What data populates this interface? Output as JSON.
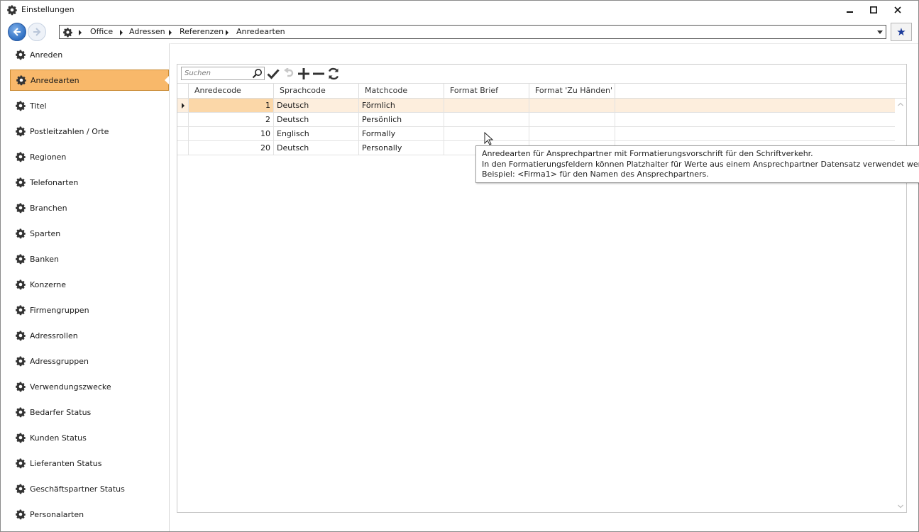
{
  "window": {
    "title": "Einstellungen",
    "controls": {
      "minimize": "minimize",
      "maximize": "maximize",
      "close": "close"
    }
  },
  "nav": {
    "breadcrumbs": [
      "Office",
      "Adressen",
      "Referenzen",
      "Anredearten"
    ],
    "favorite_icon": "star-icon"
  },
  "sidebar": {
    "selected_index": 1,
    "items": [
      {
        "label": "Anreden"
      },
      {
        "label": "Anredearten"
      },
      {
        "label": "Titel"
      },
      {
        "label": "Postleitzahlen / Orte"
      },
      {
        "label": "Regionen"
      },
      {
        "label": "Telefonarten"
      },
      {
        "label": "Branchen"
      },
      {
        "label": "Sparten"
      },
      {
        "label": "Banken"
      },
      {
        "label": "Konzerne"
      },
      {
        "label": "Firmengruppen"
      },
      {
        "label": "Adressrollen"
      },
      {
        "label": "Adressgruppen"
      },
      {
        "label": "Verwendungszwecke"
      },
      {
        "label": "Bedarfer Status"
      },
      {
        "label": "Kunden Status"
      },
      {
        "label": "Lieferanten Status"
      },
      {
        "label": "Geschäftspartner Status"
      },
      {
        "label": "Personalarten"
      }
    ]
  },
  "toolbar": {
    "search_placeholder": "Suchen",
    "search_value": "",
    "buttons": [
      "check-icon",
      "undo-icon",
      "plus-icon",
      "minus-icon",
      "refresh-icon"
    ]
  },
  "grid": {
    "columns": [
      "Anredecode",
      "Sprachcode",
      "Matchcode",
      "Format Brief",
      "Format 'Zu Händen'"
    ],
    "selected_row": 0,
    "rows": [
      {
        "code": "1",
        "sprache": "Deutsch",
        "match": "Förmlich",
        "brief": "",
        "zuhaenden": ""
      },
      {
        "code": "2",
        "sprache": "Deutsch",
        "match": "Persönlich",
        "brief": "",
        "zuhaenden": ""
      },
      {
        "code": "10",
        "sprache": "Englisch",
        "match": "Formally",
        "brief": "",
        "zuhaenden": ""
      },
      {
        "code": "20",
        "sprache": "Deutsch",
        "match": "Personally",
        "brief": "",
        "zuhaenden": ""
      }
    ]
  },
  "tooltip": {
    "lines": [
      "Anredearten für Ansprechpartner mit Formatierungsvorschrift für den Schriftverkehr.",
      "In den Formatierungsfeldern können Platzhalter für Werte aus einem Ansprechpartner Datensatz verwendet werden.",
      "Beispiel: <Firma1> für den Namen des Ansprechpartners."
    ]
  },
  "colors": {
    "selected_item_bg": "#f8b86a",
    "selected_row_bg": "#fdeedd",
    "selected_cell_bg": "#fbd7a8",
    "nav_back_blue": "#2f6fc2"
  }
}
